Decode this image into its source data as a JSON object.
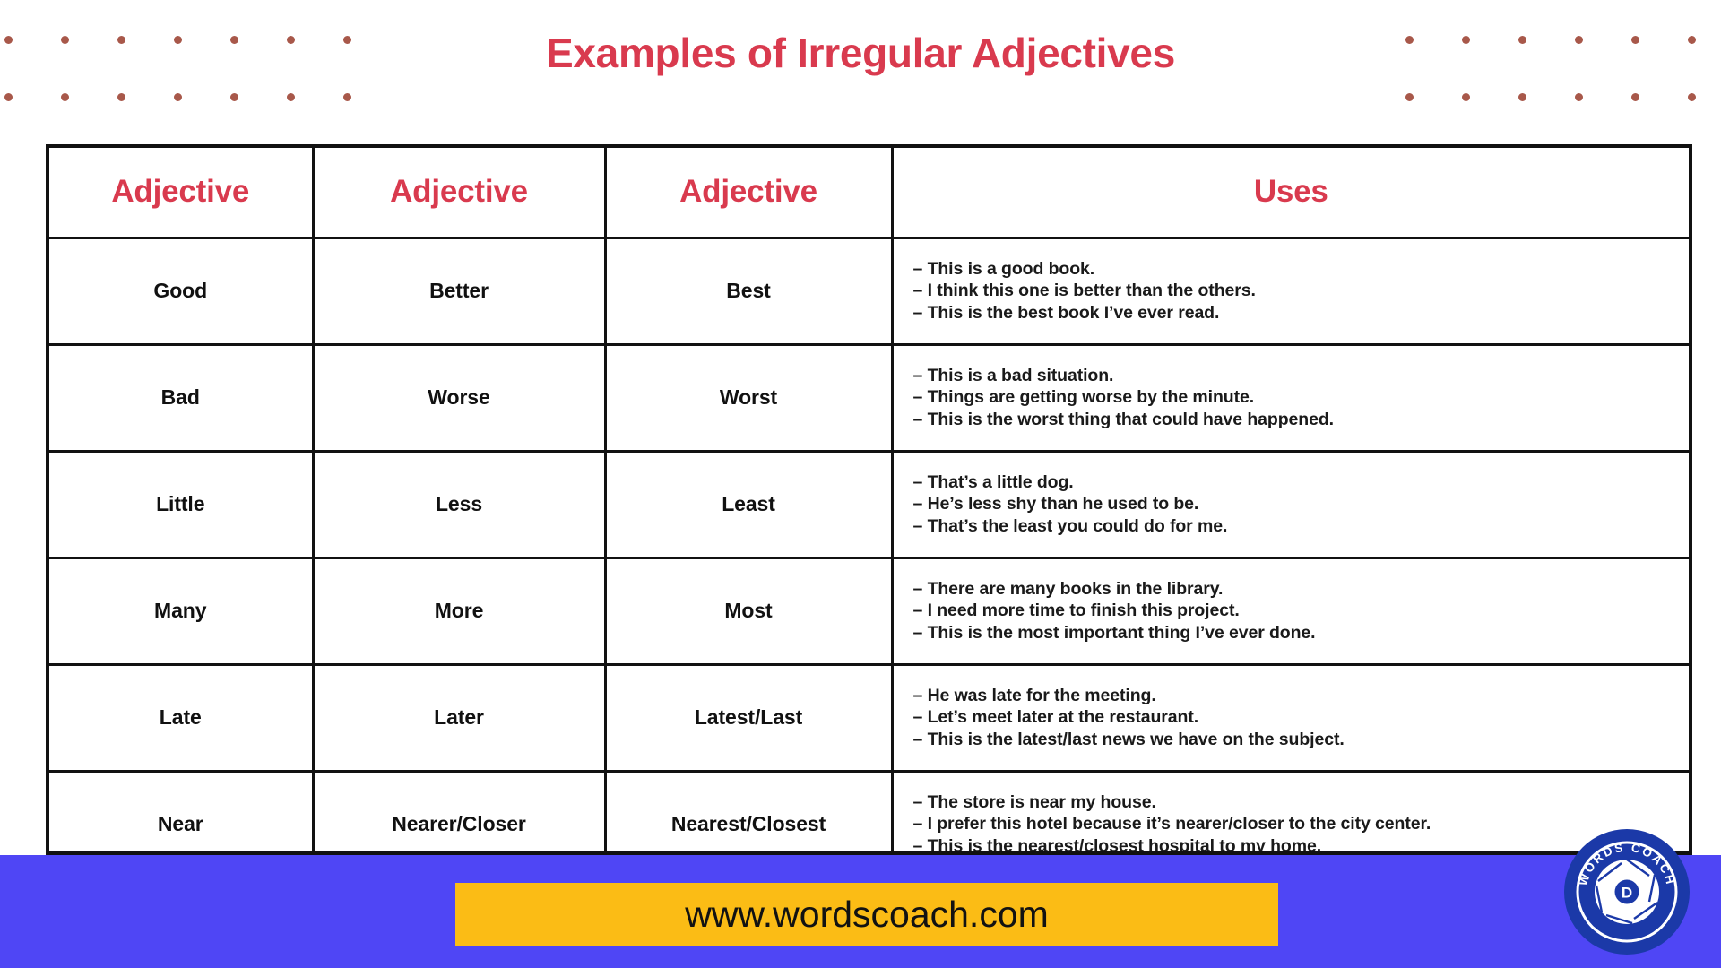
{
  "page": {
    "title": "Examples of Irregular Adjectives",
    "title_color": "#d93a4e",
    "background": "#ffffff"
  },
  "decor": {
    "dot_color": "#a8584a",
    "left_columns": 7,
    "right_columns": 6,
    "rows": 2
  },
  "table": {
    "headers": [
      "Adjective",
      "Adjective",
      "Adjective",
      "Uses"
    ],
    "rows": [
      {
        "positive": "Good",
        "comparative": "Better",
        "superlative": "Best",
        "uses": [
          "– This is a good book.",
          "– I think this one is better than the others.",
          "– This is the best book I’ve ever read."
        ]
      },
      {
        "positive": "Bad",
        "comparative": "Worse",
        "superlative": "Worst",
        "uses": [
          "– This is a bad situation.",
          "– Things are getting worse by the minute.",
          "– This is the worst thing that could have happened."
        ]
      },
      {
        "positive": "Little",
        "comparative": "Less",
        "superlative": "Least",
        "uses": [
          "– That’s a little dog.",
          "– He’s less shy than he used to be.",
          "– That’s the least you could do for me."
        ]
      },
      {
        "positive": "Many",
        "comparative": "More",
        "superlative": "Most",
        "uses": [
          "– There are many books in the library.",
          "– I need more time to finish this project.",
          "– This is the most important thing I’ve ever done."
        ]
      },
      {
        "positive": "Late",
        "comparative": "Later",
        "superlative": "Latest/Last",
        "uses": [
          "– He was late for the meeting.",
          "– Let’s meet later at the restaurant.",
          "– This is the latest/last news we have on the subject."
        ]
      },
      {
        "positive": "Near",
        "comparative": "Nearer/Closer",
        "superlative": "Nearest/Closest",
        "uses": [
          "– The store is near my house.",
          "– I prefer this hotel because it’s nearer/closer to the city center.",
          "– This is the nearest/closest hospital to my home."
        ]
      }
    ]
  },
  "footer": {
    "background": "#4f46f5",
    "url_box_color": "#fbbc15",
    "url": "www.wordscoach.com"
  },
  "logo": {
    "brand_text": "WORDS COACH",
    "center_letter": "D",
    "color": "#1b39a8"
  }
}
